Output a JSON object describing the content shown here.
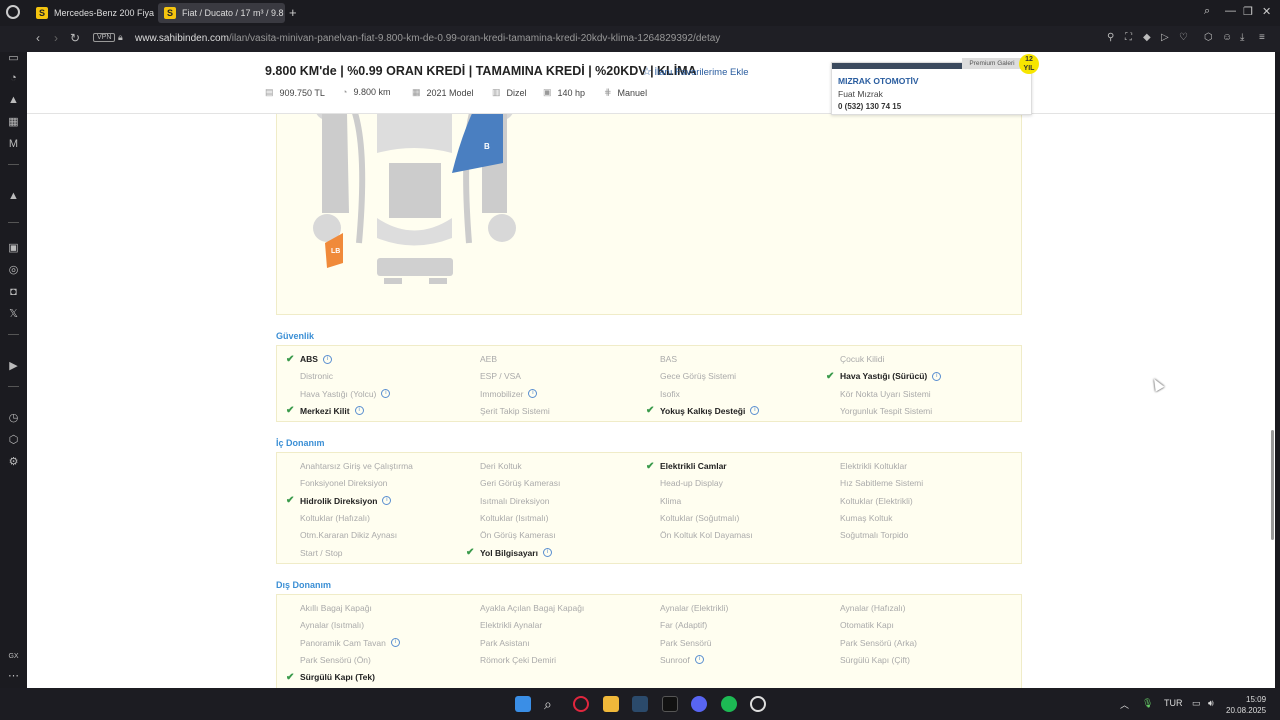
{
  "browser": {
    "tabs": [
      {
        "label": "Mercedes-Benz 200 Fiya"
      },
      {
        "label": "Fiat / Ducato / 17 m³ / 9.8"
      }
    ],
    "vpn": "VPN",
    "url_domain": "www.sahibinden.com",
    "url_path": "/ilan/vasita-minivan-panelvan-fiat-9.800-km-de-0.99-oran-kredi-tamamina-kredi-20kdv-klima-1264829392/detay"
  },
  "listing": {
    "title": "9.800 KM'de | %0.99 ORAN KREDİ | TAMAMINA KREDİ | %20KDV | KLİMA",
    "favorite_label": "İlanı Favorilerime Ekle",
    "specs": [
      {
        "icon": "price-icon",
        "value": "909.750 TL"
      },
      {
        "icon": "odometer-icon",
        "value": "9.800 km"
      },
      {
        "icon": "calendar-icon",
        "value": "2021 Model"
      },
      {
        "icon": "fuel-icon",
        "value": "Dizel"
      },
      {
        "icon": "engine-icon",
        "value": "140 hp"
      },
      {
        "icon": "gearbox-icon",
        "value": "Manuel"
      }
    ]
  },
  "seller": {
    "badge": "Premium Galeri",
    "years": "12 YIL",
    "name": "MIZRAK OTOMOTİV",
    "person": "Fuat Mızrak",
    "phone": "0 (532) 130 74 15"
  },
  "damage": {
    "labels": [
      "B",
      "LB"
    ],
    "colors": {
      "B": "#4a7fc1",
      "LB": "#f08a3a"
    }
  },
  "sections": [
    {
      "title": "Güvenlik",
      "items": [
        {
          "label": "ABS",
          "on": true,
          "info": true
        },
        {
          "label": "AEB",
          "on": false
        },
        {
          "label": "BAS",
          "on": false
        },
        {
          "label": "Çocuk Kilidi",
          "on": false
        },
        {
          "label": "Distronic",
          "on": false
        },
        {
          "label": "ESP / VSA",
          "on": false
        },
        {
          "label": "Gece Görüş Sistemi",
          "on": false
        },
        {
          "label": "Hava Yastığı (Sürücü)",
          "on": true,
          "info": true
        },
        {
          "label": "Hava Yastığı (Yolcu)",
          "on": false,
          "info": true
        },
        {
          "label": "Immobilizer",
          "on": false,
          "info": true
        },
        {
          "label": "Isofix",
          "on": false
        },
        {
          "label": "Kör Nokta Uyarı Sistemi",
          "on": false
        },
        {
          "label": "Merkezi Kilit",
          "on": true,
          "info": true
        },
        {
          "label": "Şerit Takip Sistemi",
          "on": false
        },
        {
          "label": "Yokuş Kalkış Desteği",
          "on": true,
          "info": true
        },
        {
          "label": "Yorgunluk Tespit Sistemi",
          "on": false
        }
      ]
    },
    {
      "title": "İç Donanım",
      "items": [
        {
          "label": "Anahtarsız Giriş ve Çalıştırma",
          "on": false
        },
        {
          "label": "Deri Koltuk",
          "on": false
        },
        {
          "label": "Elektrikli Camlar",
          "on": true
        },
        {
          "label": "Elektrikli Koltuklar",
          "on": false
        },
        {
          "label": "Fonksiyonel Direksiyon",
          "on": false
        },
        {
          "label": "Geri Görüş Kamerası",
          "on": false
        },
        {
          "label": "Head-up Display",
          "on": false
        },
        {
          "label": "Hız Sabitleme Sistemi",
          "on": false
        },
        {
          "label": "Hidrolik Direksiyon",
          "on": true,
          "info": true
        },
        {
          "label": "Isıtmalı Direksiyon",
          "on": false
        },
        {
          "label": "Klima",
          "on": false
        },
        {
          "label": "Koltuklar (Elektrikli)",
          "on": false
        },
        {
          "label": "Koltuklar (Hafızalı)",
          "on": false
        },
        {
          "label": "Koltuklar (Isıtmalı)",
          "on": false
        },
        {
          "label": "Koltuklar (Soğutmalı)",
          "on": false
        },
        {
          "label": "Kumaş Koltuk",
          "on": false
        },
        {
          "label": "Otm.Kararan Dikiz Aynası",
          "on": false
        },
        {
          "label": "Ön Görüş Kamerası",
          "on": false
        },
        {
          "label": "Ön Koltuk Kol Dayaması",
          "on": false
        },
        {
          "label": "Soğutmalı Torpido",
          "on": false
        },
        {
          "label": "Start / Stop",
          "on": false
        },
        {
          "label": "Yol Bilgisayarı",
          "on": true,
          "info": true
        }
      ]
    },
    {
      "title": "Dış Donanım",
      "items": [
        {
          "label": "Akıllı Bagaj Kapağı",
          "on": false
        },
        {
          "label": "Ayakla Açılan Bagaj Kapağı",
          "on": false
        },
        {
          "label": "Aynalar (Elektrikli)",
          "on": false
        },
        {
          "label": "Aynalar (Hafızalı)",
          "on": false
        },
        {
          "label": "Aynalar (Isıtmalı)",
          "on": false
        },
        {
          "label": "Elektrikli Aynalar",
          "on": false
        },
        {
          "label": "Far (Adaptif)",
          "on": false
        },
        {
          "label": "Otomatik Kapı",
          "on": false
        },
        {
          "label": "Panoramik Cam Tavan",
          "on": false,
          "info": true
        },
        {
          "label": "Park Asistanı",
          "on": false
        },
        {
          "label": "Park Sensörü",
          "on": false
        },
        {
          "label": "Park Sensörü (Arka)",
          "on": false
        },
        {
          "label": "Park Sensörü (Ön)",
          "on": false
        },
        {
          "label": "Römork Çeki Demiri",
          "on": false
        },
        {
          "label": "Sunroof",
          "on": false,
          "info": true
        },
        {
          "label": "Sürgülü Kapı (Çift)",
          "on": false
        },
        {
          "label": "Sürgülü Kapı (Tek)",
          "on": true
        }
      ]
    }
  ],
  "taskbar": {
    "lang": "TUR",
    "time": "15:09",
    "date": "20.08.2025",
    "sidebar_label": "GX"
  }
}
